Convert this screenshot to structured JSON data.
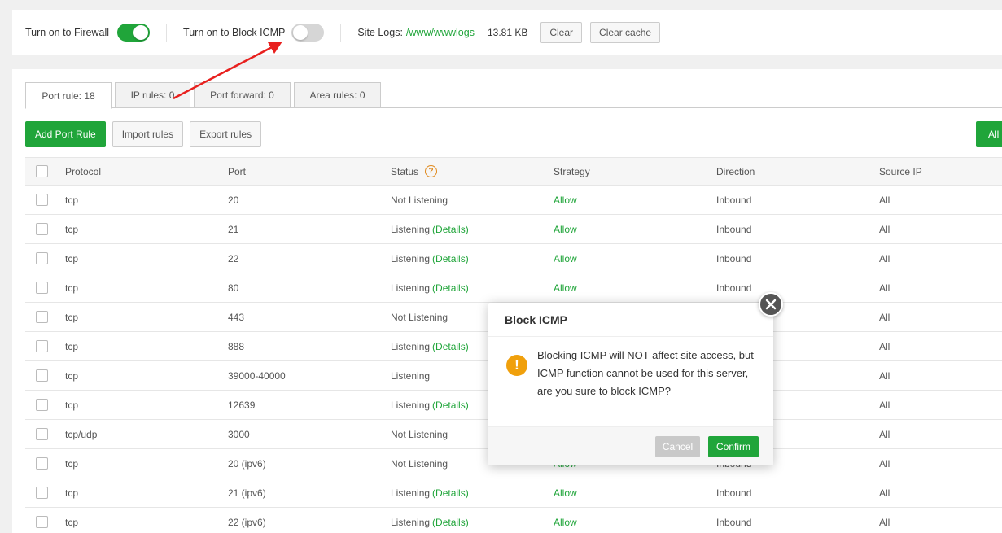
{
  "topbar": {
    "firewall_label": "Turn on to Firewall",
    "firewall_on": true,
    "icmp_label": "Turn on to Block ICMP",
    "icmp_on": false,
    "site_logs_label": "Site Logs:",
    "site_logs_path": "/www/wwwlogs",
    "log_size": "13.81 KB",
    "clear_label": "Clear",
    "clear_cache_label": "Clear cache"
  },
  "tabs": [
    {
      "label": "Port rule: 18",
      "active": true
    },
    {
      "label": "IP rules: 0",
      "active": false
    },
    {
      "label": "Port forward: 0",
      "active": false
    },
    {
      "label": "Area rules: 0",
      "active": false
    }
  ],
  "actions": {
    "add_label": "Add Port Rule",
    "import_label": "Import rules",
    "export_label": "Export rules",
    "right_label": "All"
  },
  "table": {
    "headers": [
      "Protocol",
      "Port",
      "Status",
      "Strategy",
      "Direction",
      "Source IP"
    ],
    "rows": [
      {
        "protocol": "tcp",
        "port": "20",
        "status": "Not Listening",
        "details": "",
        "strategy": "Allow",
        "direction": "Inbound",
        "source": "All"
      },
      {
        "protocol": "tcp",
        "port": "21",
        "status": "Listening",
        "details": "(Details)",
        "strategy": "Allow",
        "direction": "Inbound",
        "source": "All"
      },
      {
        "protocol": "tcp",
        "port": "22",
        "status": "Listening",
        "details": "(Details)",
        "strategy": "Allow",
        "direction": "Inbound",
        "source": "All"
      },
      {
        "protocol": "tcp",
        "port": "80",
        "status": "Listening",
        "details": "(Details)",
        "strategy": "Allow",
        "direction": "Inbound",
        "source": "All"
      },
      {
        "protocol": "tcp",
        "port": "443",
        "status": "Not Listening",
        "details": "",
        "strategy": "",
        "direction": "",
        "source": "All"
      },
      {
        "protocol": "tcp",
        "port": "888",
        "status": "Listening",
        "details": "(Details)",
        "strategy": "",
        "direction": "",
        "source": "All"
      },
      {
        "protocol": "tcp",
        "port": "39000-40000",
        "status": "Listening",
        "details": "",
        "strategy": "",
        "direction": "",
        "source": "All"
      },
      {
        "protocol": "tcp",
        "port": "12639",
        "status": "Listening",
        "details": "(Details)",
        "strategy": "",
        "direction": "",
        "source": "All"
      },
      {
        "protocol": "tcp/udp",
        "port": "3000",
        "status": "Not Listening",
        "details": "",
        "strategy": "",
        "direction": "",
        "source": "All"
      },
      {
        "protocol": "tcp",
        "port": "20 (ipv6)",
        "status": "Not Listening",
        "details": "",
        "strategy": "Allow",
        "direction": "Inbound",
        "source": "All"
      },
      {
        "protocol": "tcp",
        "port": "21 (ipv6)",
        "status": "Listening",
        "details": "(Details)",
        "strategy": "Allow",
        "direction": "Inbound",
        "source": "All"
      },
      {
        "protocol": "tcp",
        "port": "22 (ipv6)",
        "status": "Listening",
        "details": "(Details)",
        "strategy": "Allow",
        "direction": "Inbound",
        "source": "All"
      }
    ]
  },
  "modal": {
    "title": "Block ICMP",
    "message": "Blocking ICMP will NOT affect site access, but ICMP function cannot be used for this server, are you sure to block ICMP?",
    "cancel_label": "Cancel",
    "confirm_label": "Confirm"
  },
  "colors": {
    "accent_green": "#20a53a",
    "warning_orange": "#f0a00c",
    "annotation_red": "#e8201e"
  }
}
